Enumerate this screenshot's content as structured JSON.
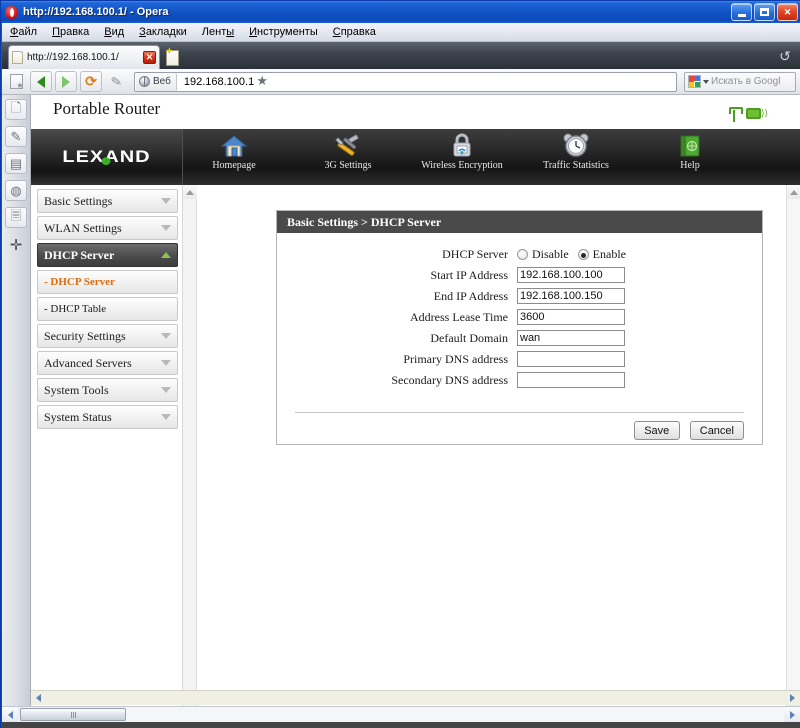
{
  "window": {
    "title": "http://192.168.100.1/ - Opera",
    "controls": {
      "minimize": "_",
      "maximize": "□",
      "close": "✕"
    }
  },
  "menubar": {
    "items": [
      {
        "label": "Файл",
        "accel": "Ф"
      },
      {
        "label": "Правка",
        "accel": "П"
      },
      {
        "label": "Вид",
        "accel": "В"
      },
      {
        "label": "Закладки",
        "accel": "З"
      },
      {
        "label": "Ленты",
        "accel": "ы"
      },
      {
        "label": "Инструменты",
        "accel": "И"
      },
      {
        "label": "Справка",
        "accel": "С"
      }
    ]
  },
  "tabbar": {
    "active_tab_label": "http://192.168.100.1/",
    "close_glyph": "✕",
    "new_tab_icon": "new-tab-icon",
    "trash_icon": "trash-icon",
    "dots": "..."
  },
  "navbar": {
    "back_icon": "back-arrow-icon",
    "forward_icon": "forward-arrow-icon",
    "reload_icon": "reload-icon",
    "edit_icon": "pen-icon",
    "address_badge": "Веб",
    "address_value": "192.168.100.1",
    "bookmark_icon": "star-icon",
    "search_placeholder": "Искать в Googl",
    "search_engine_icon": "google-icon"
  },
  "panelstrip": {
    "items": [
      {
        "icon": "bookmarks-icon"
      },
      {
        "icon": "notes-pen-icon"
      },
      {
        "icon": "wallet-icon"
      },
      {
        "icon": "history-globe-icon"
      },
      {
        "icon": "links-page-icon"
      },
      {
        "icon": "add-panel-icon",
        "glyph": "✛"
      }
    ]
  },
  "router": {
    "page_title": "Portable Router",
    "brand": "LEXAND",
    "status_icons": [
      {
        "name": "signal-antenna-icon"
      },
      {
        "name": "wlan-monitor-icon"
      }
    ],
    "nav": [
      {
        "label": "Homepage",
        "icon": "home-icon"
      },
      {
        "label": "3G Settings",
        "icon": "tools-icon"
      },
      {
        "label": "Wireless Encryption",
        "icon": "lock-wifi-icon"
      },
      {
        "label": "Traffic Statistics",
        "icon": "alarm-clock-icon"
      },
      {
        "label": "Help",
        "icon": "green-book-icon"
      }
    ],
    "sidebar": [
      {
        "label": "Basic Settings",
        "type": "group",
        "state": "collapsed"
      },
      {
        "label": "WLAN Settings",
        "type": "group",
        "state": "collapsed"
      },
      {
        "label": "DHCP Server",
        "type": "group",
        "state": "expanded",
        "active": true
      },
      {
        "label": "- DHCP Server",
        "type": "sub",
        "current": true
      },
      {
        "label": "- DHCP Table",
        "type": "sub",
        "current": false
      },
      {
        "label": "Security Settings",
        "type": "group",
        "state": "collapsed"
      },
      {
        "label": "Advanced Servers",
        "type": "group",
        "state": "collapsed"
      },
      {
        "label": "System Tools",
        "type": "group",
        "state": "collapsed"
      },
      {
        "label": "System Status",
        "type": "group",
        "state": "collapsed"
      }
    ],
    "panel": {
      "breadcrumb": "Basic Settings > DHCP Server",
      "fields": [
        {
          "label": "DHCP Server",
          "type": "radio",
          "options": [
            {
              "label": "Disable",
              "selected": false
            },
            {
              "label": "Enable",
              "selected": true
            }
          ]
        },
        {
          "label": "Start IP Address",
          "type": "text",
          "value": "192.168.100.100"
        },
        {
          "label": "End IP Address",
          "type": "text",
          "value": "192.168.100.150"
        },
        {
          "label": "Address Lease Time",
          "type": "text",
          "value": "3600"
        },
        {
          "label": "Default Domain",
          "type": "text",
          "value": "wan"
        },
        {
          "label": "Primary DNS address",
          "type": "text",
          "value": ""
        },
        {
          "label": "Secondary DNS address",
          "type": "text",
          "value": ""
        }
      ],
      "buttons": {
        "save": "Save",
        "cancel": "Cancel"
      }
    },
    "colors": {
      "panel_header_bg": "#4a4a4a",
      "nav_band_bg": "#141414",
      "active_item_bg": "#4e4e4e",
      "current_link": "#e06a10",
      "brand_dot": "#3fae2a",
      "status_green": "#4d9e1f"
    }
  }
}
